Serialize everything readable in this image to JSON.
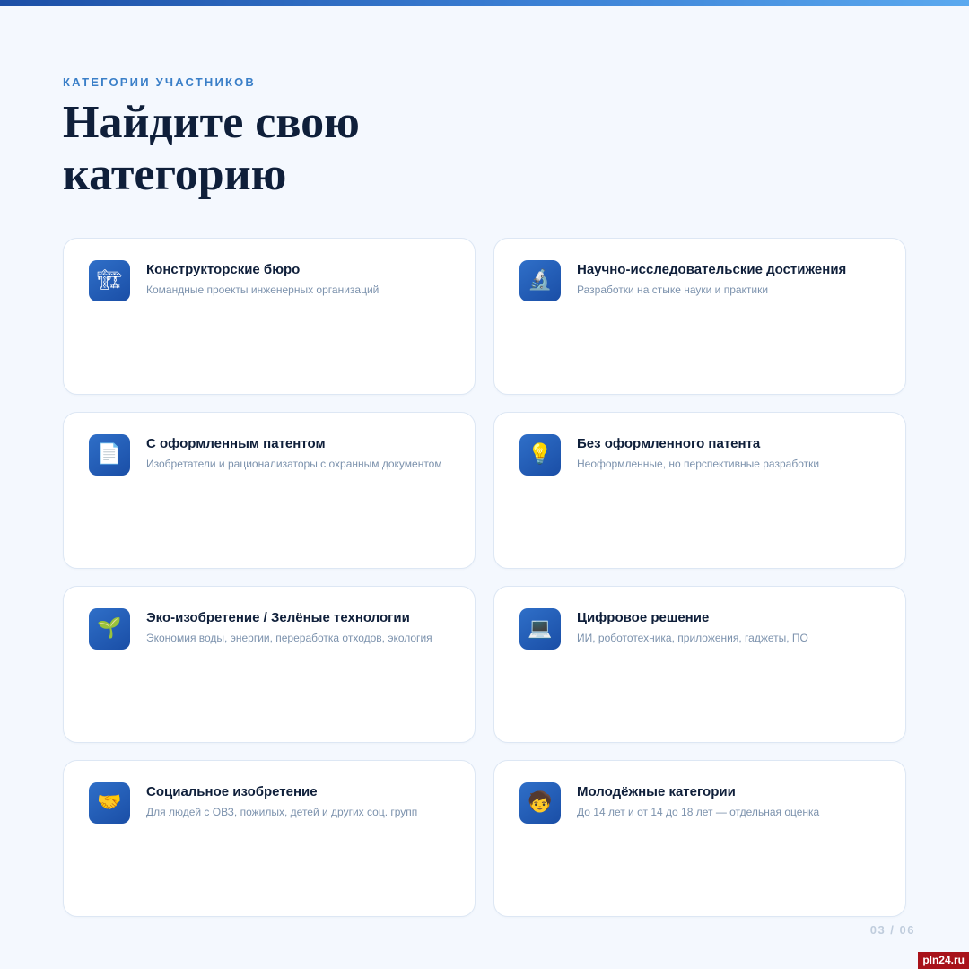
{
  "header": {
    "eyebrow": "КАТЕГОРИИ УЧАСТНИКОВ",
    "title_line1": "Найдите свою",
    "title_line2": "категорию"
  },
  "colors": {
    "accent": "#3a7fc8",
    "icon_bg": "#1f5bb5",
    "title": "#0f1f3a",
    "description": "#7c92ad"
  },
  "cards": [
    {
      "icon": "crane-icon",
      "glyph": "🏗",
      "title": "Конструкторские бюро",
      "desc": "Командные проекты инженерных организаций"
    },
    {
      "icon": "microscope-icon",
      "glyph": "🔬",
      "title": "Научно-исследовательские достижения",
      "desc": "Разработки на стыке науки и практики"
    },
    {
      "icon": "document-icon",
      "glyph": "📄",
      "title": "С оформленным патентом",
      "desc": "Изобретатели и рационализаторы с охранным документом"
    },
    {
      "icon": "lightbulb-icon",
      "glyph": "💡",
      "title": "Без оформленного патента",
      "desc": "Неоформленные, но перспективные разработки"
    },
    {
      "icon": "seedling-icon",
      "glyph": "🌱",
      "title": "Эко-изобретение / Зелёные технологии",
      "desc": "Экономия воды, энергии, переработка отходов, экология"
    },
    {
      "icon": "laptop-icon",
      "glyph": "💻",
      "title": "Цифровое решение",
      "desc": "ИИ, робототехника, приложения, гаджеты, ПО"
    },
    {
      "icon": "handshake-icon",
      "glyph": "🤝",
      "title": "Социальное изобретение",
      "desc": "Для людей с ОВЗ, пожилых, детей и других соц. групп"
    },
    {
      "icon": "child-icon",
      "glyph": "🧒",
      "title": "Молодёжные категории",
      "desc": "До 14 лет и от 14 до 18 лет — отдельная оценка"
    }
  ],
  "footer": {
    "page": "03 / 06",
    "watermark": "pln24.ru"
  }
}
